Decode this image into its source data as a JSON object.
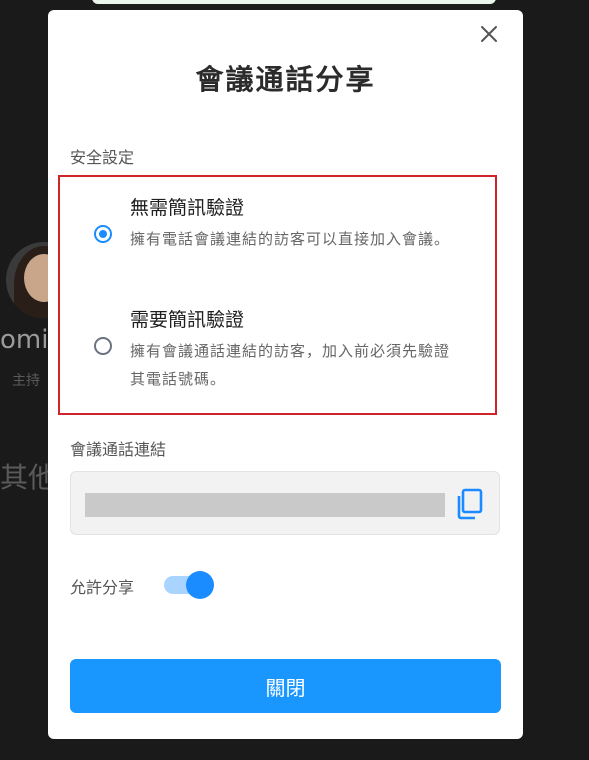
{
  "background": {
    "name_fragment": "omi",
    "subtitle_fragment": "主持",
    "other_fragment": "其他"
  },
  "dialog": {
    "title": "會議通話分享",
    "close_icon": "close-icon",
    "security": {
      "label": "安全設定",
      "options": [
        {
          "title": "無需簡訊驗證",
          "description": "擁有電話會議連結的訪客可以直接加入會議。",
          "selected": true
        },
        {
          "title": "需要簡訊驗證",
          "description": "擁有會議通話連結的訪客，加入前必須先驗證其電話號碼。",
          "selected": false
        }
      ]
    },
    "link": {
      "label": "會議通話連結",
      "value": "",
      "copy_icon": "copy-icon"
    },
    "share": {
      "label": "允許分享",
      "enabled": true
    },
    "close_button_label": "關閉",
    "colors": {
      "accent": "#1a96ff",
      "highlight_border": "#d0242b"
    }
  }
}
